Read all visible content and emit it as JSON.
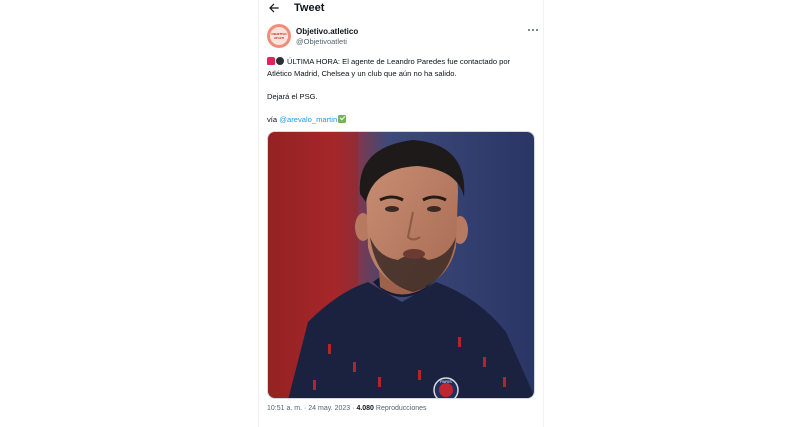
{
  "header": {
    "title": "Tweet"
  },
  "tweet": {
    "author": {
      "display_name": "Objetivo.atletico",
      "handle": "@Objetivoatleti",
      "avatar_text": "OBJETIVO ATLETI"
    },
    "text_line1": "ÚLTIMA HORA: El agente de Leandro Paredes fue contactado por",
    "text_line2": "Atlético Madrid, Chelsea y un club que aún no ha salido.",
    "text_line3": "Dejará el PSG.",
    "via_label": "vía",
    "mention": "@arevalo_martin",
    "photo_crest_text": "PARIS",
    "time": "10:51 a. m.",
    "separator": "·",
    "date": "24 may. 2023",
    "views_count": "4.080",
    "views_label": "Reproducciones"
  },
  "colors": {
    "accent": "#1d9bf0",
    "text": "#0f1419",
    "secondary_text": "#536471",
    "check_emoji": "#77b255",
    "siren_emoji": "#e0245e"
  },
  "icons": [
    "arrow-left-icon",
    "more-horizontal-icon",
    "siren-emoji-icon",
    "bomb-emoji-icon",
    "check-mark-emoji-icon"
  ]
}
